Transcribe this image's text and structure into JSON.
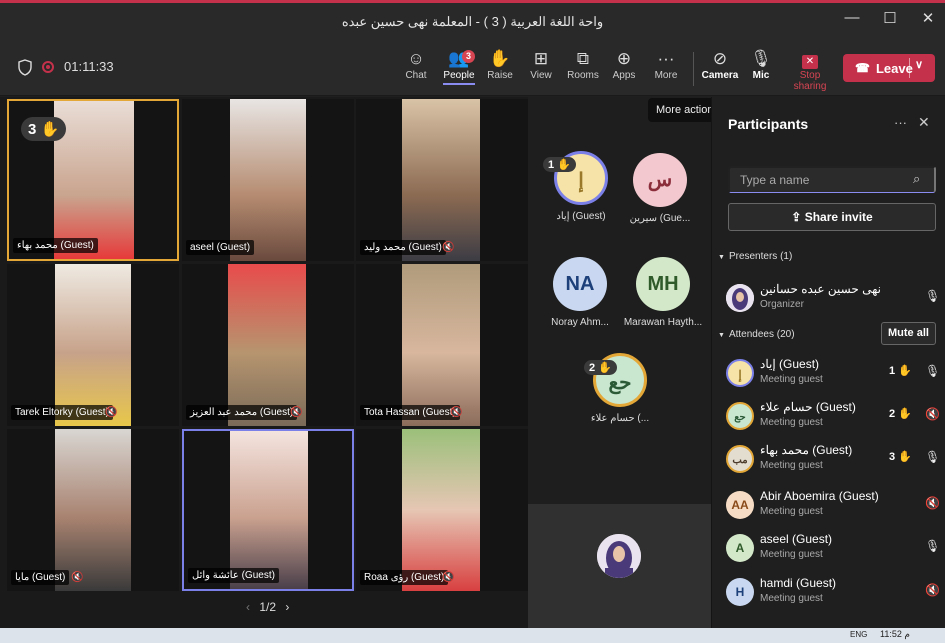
{
  "window": {
    "title": "واحة اللغة العربية ( 3 ) - المعلمة نهى حسين عبده",
    "minimize": "—",
    "maximize": "☐",
    "close": "✕"
  },
  "toolbar": {
    "timer": "01:11:33",
    "buttons": [
      {
        "label": "Chat",
        "icon": "chat-icon",
        "glyph": "☺"
      },
      {
        "label": "People",
        "icon": "people-icon",
        "glyph": "👥",
        "badge": "3"
      },
      {
        "label": "Raise",
        "icon": "hand-icon",
        "glyph": "✋"
      },
      {
        "label": "View",
        "icon": "grid-icon",
        "glyph": "⊞"
      },
      {
        "label": "Rooms",
        "icon": "rooms-icon",
        "glyph": "⧉"
      },
      {
        "label": "Apps",
        "icon": "apps-icon",
        "glyph": "⊕"
      },
      {
        "label": "More",
        "icon": "more-icon",
        "glyph": "···"
      },
      {
        "label": "Camera",
        "icon": "camera-off-icon",
        "glyph": "⊘"
      },
      {
        "label": "Mic",
        "icon": "mic-icon",
        "glyph": "🎙"
      },
      {
        "label": "Stop sharing",
        "icon": "stop-share-icon",
        "glyph": "✕"
      }
    ],
    "leave_label": "Leave"
  },
  "tooltip": "More actions",
  "grid": {
    "tiles": [
      {
        "name": "محمد بهاء (Guest)",
        "hand": "3",
        "muted": false
      },
      {
        "name": "aseel (Guest)",
        "muted": false
      },
      {
        "name": "محمد وليد (Guest)",
        "muted": true
      },
      {
        "name": "Tarek Eltorky (Guest)",
        "muted": true
      },
      {
        "name": "محمد عبد العزيز (Guest)",
        "muted": true
      },
      {
        "name": "Tota Hassan (Guest)",
        "muted": true
      },
      {
        "name": "مايا (Guest)",
        "muted": true
      },
      {
        "name": "عائشة وائل (Guest)",
        "muted": false
      },
      {
        "name": "Roaa رؤى (Guest)",
        "muted": true
      }
    ],
    "pager": "1/2"
  },
  "side_tiles": [
    {
      "initials": "إ",
      "label": "إياد (Guest)",
      "hand": "1"
    },
    {
      "initials": "س",
      "label": "سيرين (Gue..."
    },
    {
      "initials": "NA",
      "label": "Noray Ahm..."
    },
    {
      "initials": "MH",
      "label": "Marawan Hayth..."
    },
    {
      "initials": "حع",
      "label": "حسام علاء (...",
      "hand": "2"
    }
  ],
  "participants": {
    "title": "Participants",
    "search_placeholder": "Type a name",
    "invite_label": "Share invite",
    "presenters_header": "Presenters (1)",
    "attendees_header": "Attendees (20)",
    "mute_all": "Mute all",
    "presenters": [
      {
        "name": "نهى حسين عبده حسانين",
        "role": "Organizer"
      }
    ],
    "attendees": [
      {
        "initials": "إ",
        "name": "إياد (Guest)",
        "role": "Meeting guest",
        "hand": "1"
      },
      {
        "initials": "حع",
        "name": "حسام علاء (Guest)",
        "role": "Meeting guest",
        "hand": "2"
      },
      {
        "initials": "مب",
        "name": "محمد بهاء (Guest)",
        "role": "Meeting guest",
        "hand": "3"
      },
      {
        "initials": "AA",
        "name": "Abir Aboemira (Guest)",
        "role": "Meeting guest"
      },
      {
        "initials": "A",
        "name": "aseel (Guest)",
        "role": "Meeting guest"
      },
      {
        "initials": "H",
        "name": "hamdi (Guest)",
        "role": "Meeting guest"
      }
    ]
  },
  "taskbar": {
    "time": "11:52 م",
    "lang": "ENG"
  },
  "colors": {
    "accent": "#7b80e8",
    "leave": "#c4314b",
    "hand": "#f1c232",
    "highlight": "#e2a737"
  }
}
